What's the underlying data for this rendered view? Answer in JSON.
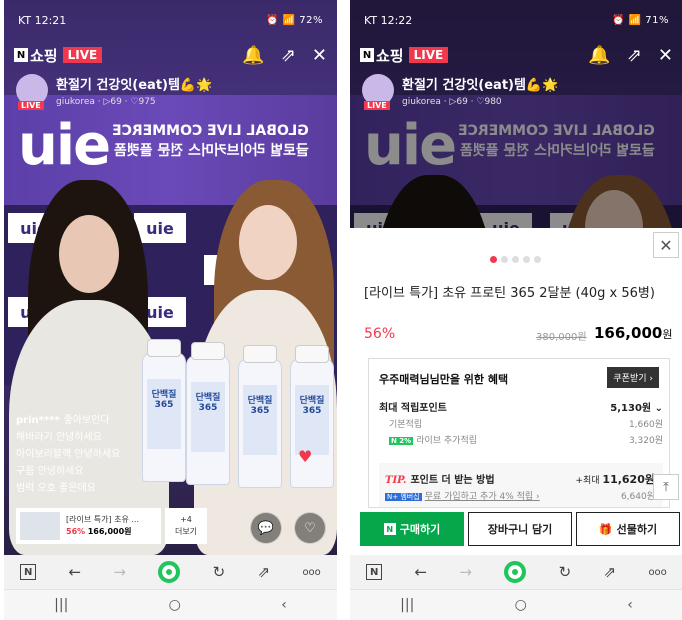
{
  "left": {
    "status": {
      "time": "KT 12:21",
      "right": "⏰ 📶 72%"
    },
    "brand": {
      "n": "N",
      "shop": "쇼핑",
      "live": "LIVE"
    },
    "channel": {
      "title": "환절기 건강잇(eat)템💪🌟",
      "meta": "giukorea · ▷69 · ♡975",
      "avatar_tag": "LIVE"
    },
    "banner": {
      "logo": "uie",
      "mirror_line1": "GLOBAL LIVE COMMERCE",
      "mirror_line2": "글로벌 라이브커머스 전문 플랫폼"
    },
    "bottle_label": "단백질 365",
    "chat": [
      {
        "user": "prin****",
        "msg": "좋아보인다"
      },
      {
        "user": "",
        "msg": "해바라기 안녕하세요"
      },
      {
        "user": "",
        "msg": "아이보리블랙 안녕하세요"
      },
      {
        "user": "",
        "msg": "구름 안녕하세요"
      },
      {
        "user": "",
        "msg": "범럭 오호 좋은데요"
      }
    ],
    "product": {
      "name": "[라이브 특가] 초유 ...",
      "discount": "56%",
      "price": "166,000원"
    },
    "more": {
      "count": "+4",
      "label": "더보기"
    }
  },
  "right": {
    "status": {
      "time": "KT 12:22",
      "right": "⏰ 📶 71%"
    },
    "channel": {
      "title": "환절기 건강잇(eat)템💪🌟",
      "meta": "giukorea · ▷69 · ♡980"
    },
    "product": {
      "title": "[라이브 특가] 초유 프로틴 365 2달분 (40g x 56병)",
      "discount": "56%",
      "original_price": "380,000원",
      "final_price": "166,000",
      "won": "원"
    },
    "benefit": {
      "header": "우주매력님님만을 위한 혜택",
      "coupon_label": "쿠폰받기 ›",
      "max_points_label": "최대 적립포인트",
      "max_points_value": "5,130원 ⌄",
      "basic_label": "기본적립",
      "basic_value": "1,660원",
      "live_tag": "N 2%",
      "live_label": "라이브 추가적립",
      "live_value": "3,320원",
      "tip_prefix": "TIP.",
      "tip_label": "포인트 더 받는 방법",
      "tip_max_prefix": "+최대",
      "tip_max_value": "11,620원",
      "tip_member_tag": "N+ 멤버십",
      "tip_row": "무료 가입하고 추가 4% 적립 ›",
      "tip_row_value": "6,640원"
    },
    "actions": {
      "buy": "구매하기",
      "cart": "장바구니 담기",
      "gift": "선물하기"
    }
  },
  "browser": {
    "n": "N",
    "back": "←",
    "fwd": "→",
    "refresh": "↻",
    "share": "⇗",
    "more": "ooo"
  },
  "navbar": {
    "recent": "|||",
    "home": "○",
    "back": "‹"
  }
}
